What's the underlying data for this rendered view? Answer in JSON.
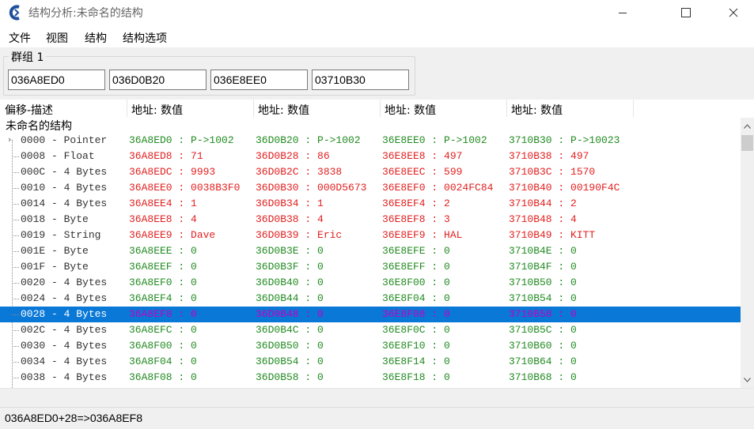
{
  "window": {
    "title": "结构分析:未命名的结构"
  },
  "menu": [
    "文件",
    "视图",
    "结构",
    "结构选项"
  ],
  "group": {
    "title": "群组 1",
    "addresses": [
      "036A8ED0",
      "036D0B20",
      "036E8EE0",
      "03710B30"
    ]
  },
  "columns": [
    "偏移-描述",
    "地址: 数值",
    "地址: 数值",
    "地址: 数值",
    "地址: 数值"
  ],
  "tree": {
    "root_label": "未命名的结构",
    "rows": [
      {
        "desc": "0000 - Pointer",
        "cells": [
          "36A8ED0 : P->1002",
          "36D0B20 : P->1002",
          "36E8EE0 : P->1002",
          "3710B30 : P->10023"
        ],
        "colors": [
          "green",
          "green",
          "green",
          "green"
        ],
        "selected": false
      },
      {
        "desc": "0008 - Float",
        "cells": [
          "36A8ED8 : 71",
          "36D0B28 : 86",
          "36E8EE8 : 497",
          "3710B38 : 497"
        ],
        "colors": [
          "red",
          "red",
          "red",
          "red"
        ],
        "selected": false
      },
      {
        "desc": "000C - 4 Bytes",
        "cells": [
          "36A8EDC : 9993",
          "36D0B2C : 3838",
          "36E8EEC : 599",
          "3710B3C : 1570"
        ],
        "colors": [
          "red",
          "red",
          "red",
          "red"
        ],
        "selected": false
      },
      {
        "desc": "0010 - 4 Bytes",
        "cells": [
          "36A8EE0 : 0038B3F0",
          "36D0B30 : 000D5673",
          "36E8EF0 : 0024FC84",
          "3710B40 : 00190F4C"
        ],
        "colors": [
          "red",
          "red",
          "red",
          "red"
        ],
        "selected": false
      },
      {
        "desc": "0014 - 4 Bytes",
        "cells": [
          "36A8EE4 : 1",
          "36D0B34 : 1",
          "36E8EF4 : 2",
          "3710B44 : 2"
        ],
        "colors": [
          "red",
          "red",
          "red",
          "red"
        ],
        "selected": false
      },
      {
        "desc": "0018 - Byte",
        "cells": [
          "36A8EE8 : 4",
          "36D0B38 : 4",
          "36E8EF8 : 3",
          "3710B48 : 4"
        ],
        "colors": [
          "red",
          "red",
          "red",
          "red"
        ],
        "selected": false
      },
      {
        "desc": "0019 - String",
        "cells": [
          "36A8EE9 : Dave",
          "36D0B39 : Eric",
          "36E8EF9 : HAL",
          "3710B49 : KITT"
        ],
        "colors": [
          "red",
          "red",
          "red",
          "red"
        ],
        "selected": false
      },
      {
        "desc": "001E - Byte",
        "cells": [
          "36A8EEE : 0",
          "36D0B3E : 0",
          "36E8EFE : 0",
          "3710B4E : 0"
        ],
        "colors": [
          "green",
          "green",
          "green",
          "green"
        ],
        "selected": false
      },
      {
        "desc": "001F - Byte",
        "cells": [
          "36A8EEF : 0",
          "36D0B3F : 0",
          "36E8EFF : 0",
          "3710B4F : 0"
        ],
        "colors": [
          "green",
          "green",
          "green",
          "green"
        ],
        "selected": false
      },
      {
        "desc": "0020 - 4 Bytes",
        "cells": [
          "36A8EF0 : 0",
          "36D0B40 : 0",
          "36E8F00 : 0",
          "3710B50 : 0"
        ],
        "colors": [
          "green",
          "green",
          "green",
          "green"
        ],
        "selected": false
      },
      {
        "desc": "0024 - 4 Bytes",
        "cells": [
          "36A8EF4 : 0",
          "36D0B44 : 0",
          "36E8F04 : 0",
          "3710B54 : 0"
        ],
        "colors": [
          "green",
          "green",
          "green",
          "green"
        ],
        "selected": false
      },
      {
        "desc": "0028 - 4 Bytes",
        "cells": [
          "36A8EF8 : 0",
          "36D0B48 : 0",
          "36E8F08 : 0",
          "3710B58 : 0"
        ],
        "colors": [
          "sel",
          "sel",
          "sel",
          "sel"
        ],
        "selected": true
      },
      {
        "desc": "002C - 4 Bytes",
        "cells": [
          "36A8EFC : 0",
          "36D0B4C : 0",
          "36E8F0C : 0",
          "3710B5C : 0"
        ],
        "colors": [
          "green",
          "green",
          "green",
          "green"
        ],
        "selected": false
      },
      {
        "desc": "0030 - 4 Bytes",
        "cells": [
          "36A8F00 : 0",
          "36D0B50 : 0",
          "36E8F10 : 0",
          "3710B60 : 0"
        ],
        "colors": [
          "green",
          "green",
          "green",
          "green"
        ],
        "selected": false
      },
      {
        "desc": "0034 - 4 Bytes",
        "cells": [
          "36A8F04 : 0",
          "36D0B54 : 0",
          "36E8F14 : 0",
          "3710B64 : 0"
        ],
        "colors": [
          "green",
          "green",
          "green",
          "green"
        ],
        "selected": false
      },
      {
        "desc": "0038 - 4 Bytes",
        "cells": [
          "36A8F08 : 0",
          "36D0B58 : 0",
          "36E8F18 : 0",
          "3710B68 : 0"
        ],
        "colors": [
          "green",
          "green",
          "green",
          "green"
        ],
        "selected": false
      }
    ]
  },
  "status": {
    "text": "036A8ED0+28=>036A8EF8"
  },
  "icons": {
    "app": "cheat-engine-icon",
    "expand": "chevron-right-icon",
    "scroll_up": "arrow-up-icon",
    "scroll_down": "arrow-down-icon"
  },
  "colors": {
    "selection": "#0a78d7",
    "value_green": "#228b22",
    "value_red": "#e22020",
    "selected_text": "#c000c0"
  }
}
